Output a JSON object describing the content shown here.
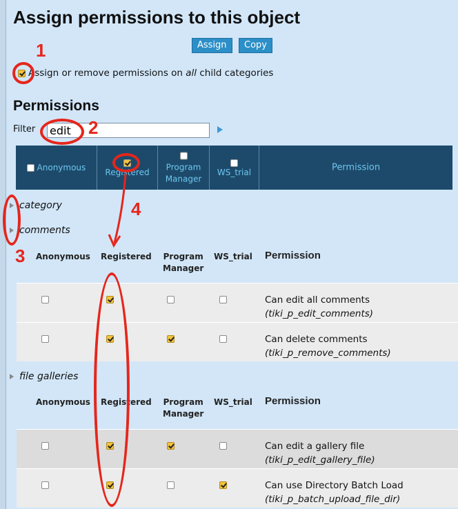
{
  "page": {
    "title": "Assign permissions to this object",
    "assign_label": "Assign",
    "copy_label": "Copy",
    "child_text_pre": "Assign or remove permissions on ",
    "child_text_em": "all",
    "child_text_post": " child categories",
    "permissions_heading": "Permissions",
    "filter_label": "Filter",
    "filter_value": "edit"
  },
  "header_row": {
    "anonymous": "Anonymous",
    "registered": "Registered",
    "program": "Program",
    "manager": "Manager",
    "ws_trial": "WS_trial",
    "permission": "Permission"
  },
  "categories": {
    "category": "category",
    "comments": "comments",
    "file_galleries": "file galleries"
  },
  "col_headers": {
    "anonymous": "Anonymous",
    "registered": "Registered",
    "program": "Program",
    "manager": "Manager",
    "ws_trial": "WS_trial",
    "permission": "Permission"
  },
  "rows": [
    {
      "label": "Can edit all comments",
      "code": "(tiki_p_edit_comments)",
      "checks": [
        false,
        true,
        false,
        false
      ]
    },
    {
      "label": "Can delete comments",
      "code": "(tiki_p_remove_comments)",
      "checks": [
        false,
        true,
        true,
        false
      ]
    },
    {
      "label": "Can edit a gallery file",
      "code": "(tiki_p_edit_gallery_file)",
      "checks": [
        false,
        true,
        true,
        false
      ]
    },
    {
      "label": "Can use Directory Batch Load",
      "code": "(tiki_p_batch_upload_file_dir)",
      "checks": [
        false,
        true,
        false,
        true
      ]
    }
  ],
  "annotations": {
    "n1": "1",
    "n2": "2",
    "n3": "3",
    "n4": "4"
  },
  "colors": {
    "accent": "#2c8fc7",
    "header_bg": "#1d4a6b",
    "annotation": "#e5261c",
    "checked": "#f3c33a"
  }
}
